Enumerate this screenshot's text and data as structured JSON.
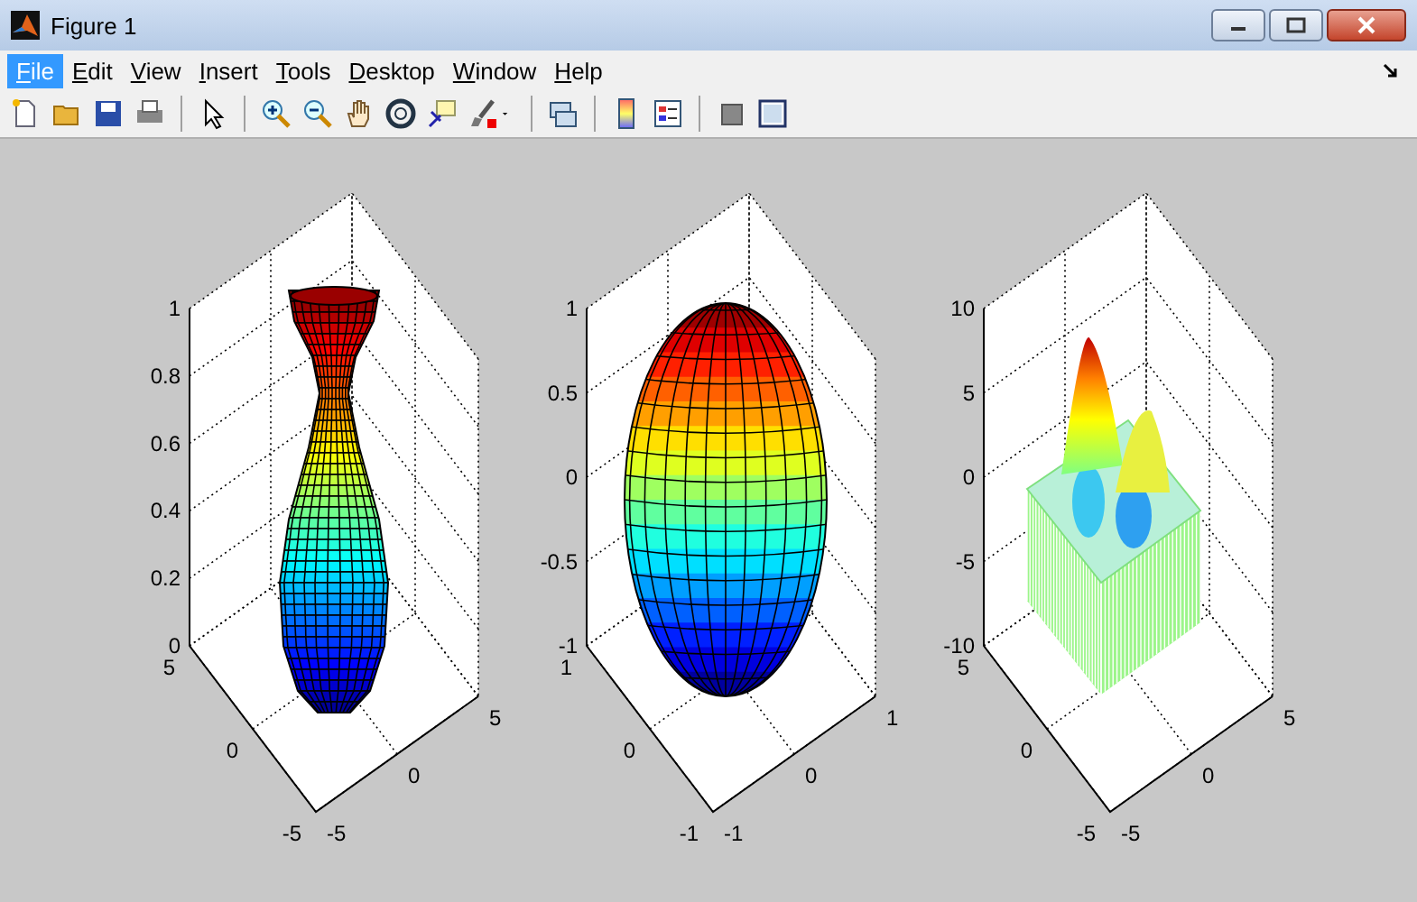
{
  "window": {
    "title": "Figure 1"
  },
  "menu": [
    {
      "label": "File",
      "selected": true
    },
    {
      "label": "Edit",
      "selected": false
    },
    {
      "label": "View",
      "selected": false
    },
    {
      "label": "Insert",
      "selected": false
    },
    {
      "label": "Tools",
      "selected": false
    },
    {
      "label": "Desktop",
      "selected": false
    },
    {
      "label": "Window",
      "selected": false
    },
    {
      "label": "Help",
      "selected": false
    }
  ],
  "axes": [
    {
      "kind": "vase",
      "z_ticks": [
        "1",
        "0.8",
        "0.6",
        "0.4",
        "0.2",
        "0"
      ],
      "y_ticks": [
        "5",
        "0",
        "-5"
      ],
      "x_ticks": [
        "-5",
        "0",
        "5"
      ]
    },
    {
      "kind": "ellipsoid",
      "z_ticks": [
        "1",
        "0.5",
        "0",
        "-0.5",
        "-1"
      ],
      "y_ticks": [
        "1",
        "0",
        "-1"
      ],
      "x_ticks": [
        "-1",
        "0",
        "1"
      ]
    },
    {
      "kind": "mesh",
      "z_ticks": [
        "10",
        "5",
        "0",
        "-5",
        "-10"
      ],
      "y_ticks": [
        "5",
        "0",
        "-5"
      ],
      "x_ticks": [
        "-5",
        "0",
        "5"
      ]
    }
  ]
}
